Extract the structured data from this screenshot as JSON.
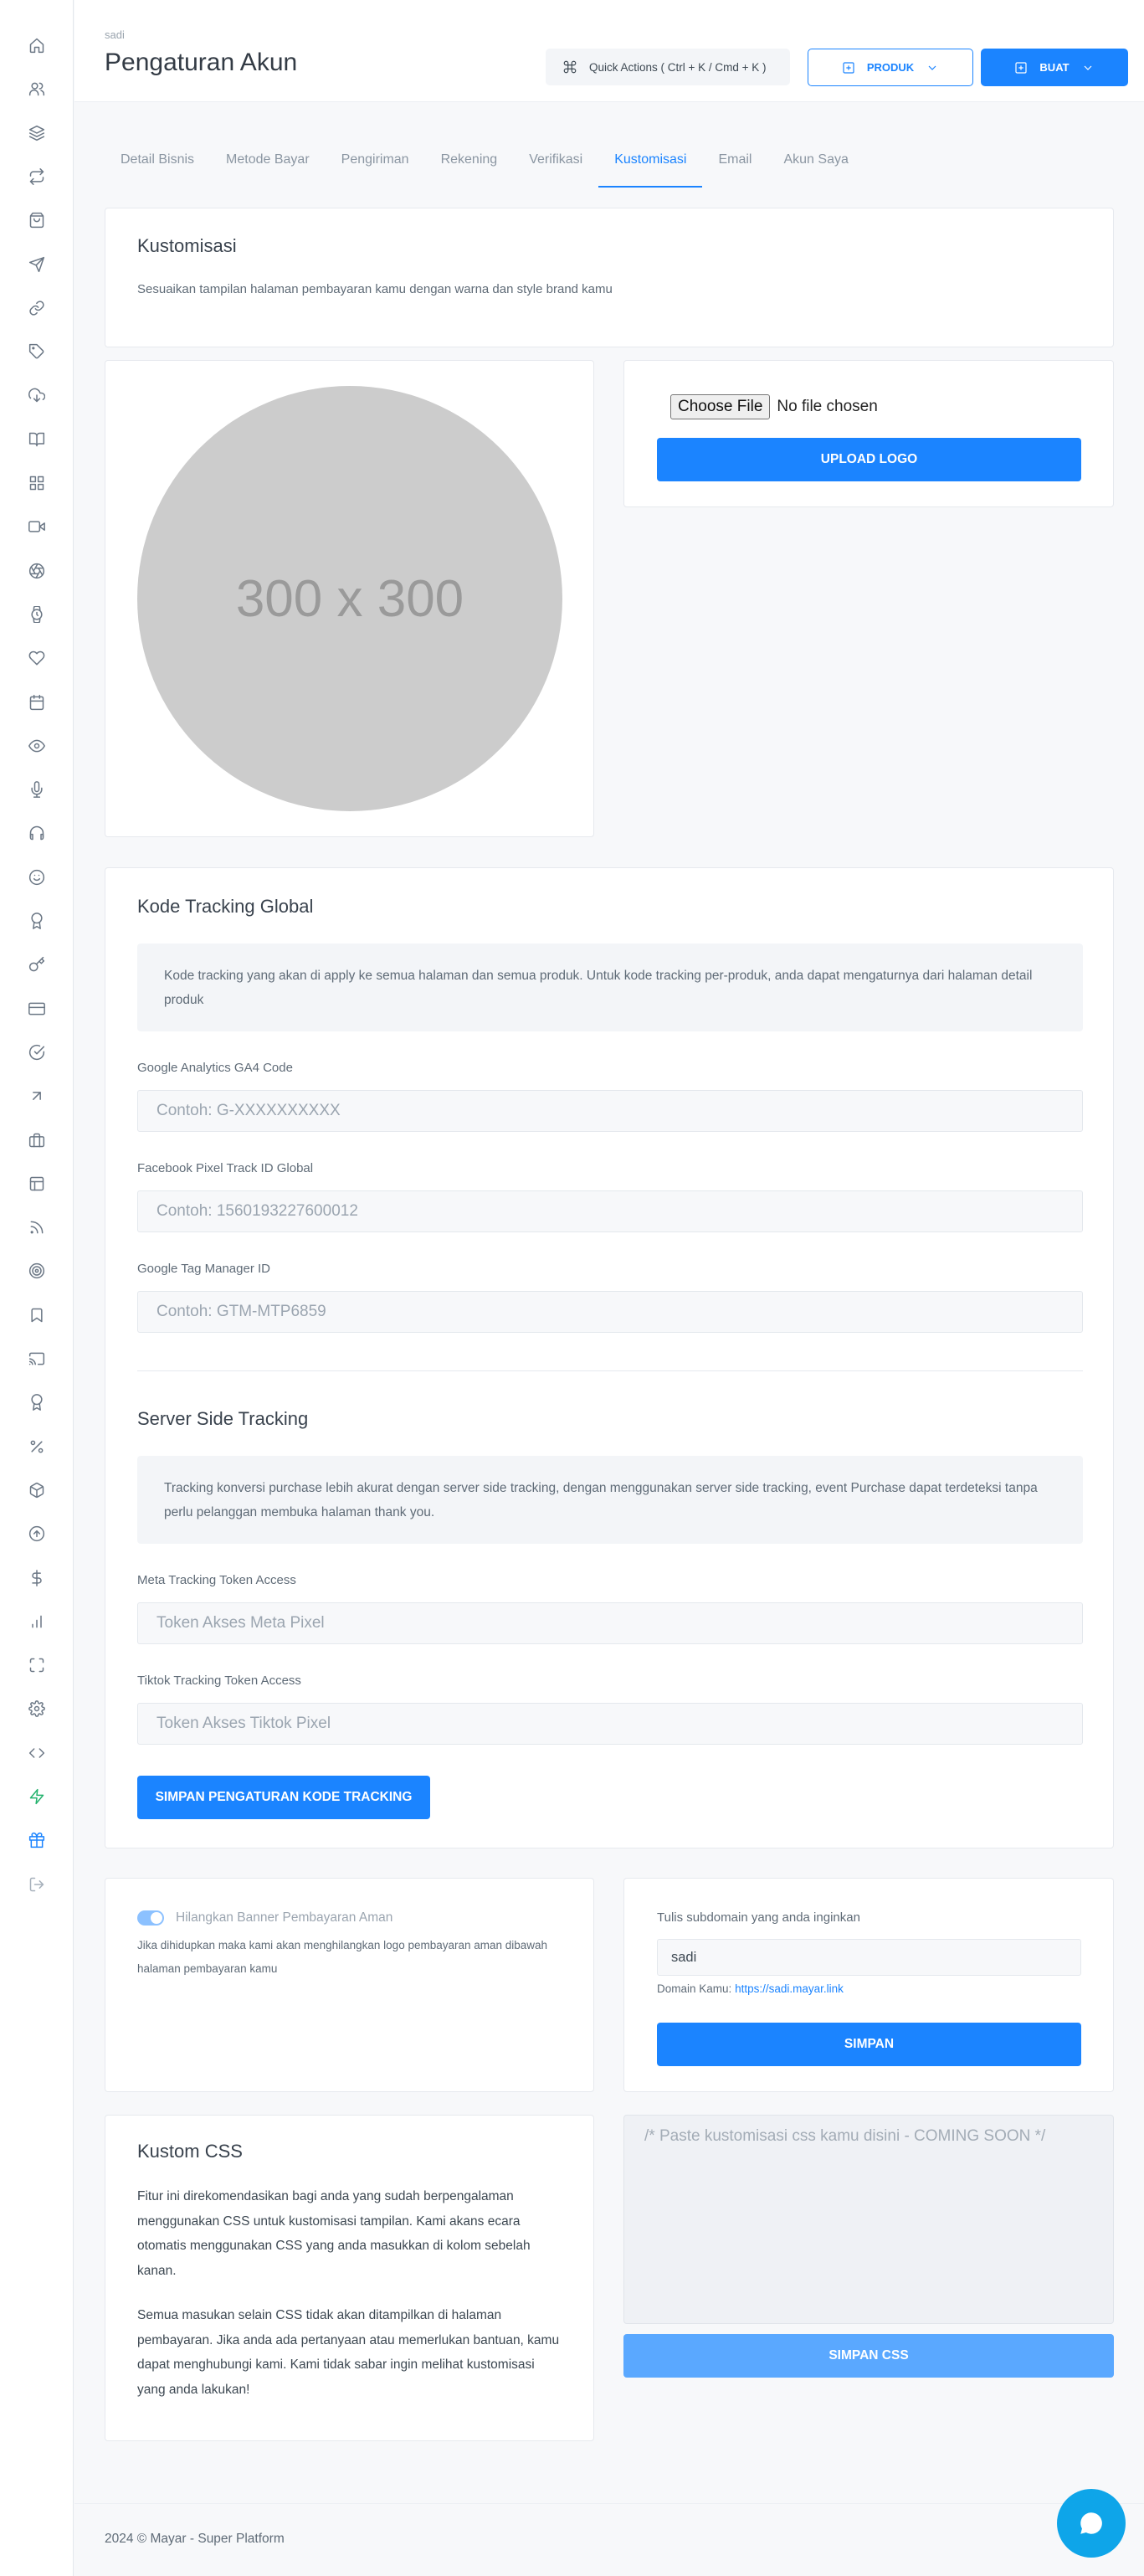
{
  "header": {
    "breadcrumb": "sadi",
    "title": "Pengaturan Akun",
    "quick_actions": "Quick Actions ( Ctrl + K / Cmd + K )",
    "produk_button": "PRODUK",
    "buat_button": "BUAT"
  },
  "tabs": [
    "Detail Bisnis",
    "Metode Bayar",
    "Pengiriman",
    "Rekening",
    "Verifikasi",
    "Kustomisasi",
    "Email",
    "Akun Saya"
  ],
  "active_tab": "Kustomisasi",
  "kustomisasi": {
    "title": "Kustomisasi",
    "description": "Sesuaikan tampilan halaman pembayaran kamu dengan warna dan style brand kamu"
  },
  "logo": {
    "placeholder_text": "300 x 300",
    "choose_file": "Choose File",
    "no_file": "No file chosen",
    "upload_button": "UPLOAD LOGO"
  },
  "tracking": {
    "title": "Kode Tracking Global",
    "info": "Kode tracking yang akan di apply ke semua halaman dan semua produk. Untuk kode tracking per-produk, anda dapat mengaturnya dari halaman detail produk",
    "ga4_label": "Google Analytics GA4 Code",
    "ga4_placeholder": "Contoh: G-XXXXXXXXXX",
    "fb_label": "Facebook Pixel Track ID Global",
    "fb_placeholder": "Contoh: 1560193227600012",
    "gtm_label": "Google Tag Manager ID",
    "gtm_placeholder": "Contoh: GTM-MTP6859",
    "server_title": "Server Side Tracking",
    "server_info": "Tracking konversi purchase lebih akurat dengan server side tracking, dengan menggunakan server side tracking, event Purchase dapat terdeteksi tanpa perlu pelanggan membuka halaman thank you.",
    "meta_label": "Meta Tracking Token Access",
    "meta_placeholder": "Token Akses Meta Pixel",
    "tiktok_label": "Tiktok Tracking Token Access",
    "tiktok_placeholder": "Token Akses Tiktok Pixel",
    "save_button": "SIMPAN PENGATURAN KODE TRACKING"
  },
  "banner": {
    "toggle_label": "Hilangkan Banner Pembayaran Aman",
    "toggle_on": true,
    "description": "Jika dihidupkan maka kami akan menghilangkan logo pembayaran aman dibawah halaman pembayaran kamu"
  },
  "subdomain": {
    "label": "Tulis subdomain yang anda inginkan",
    "value": "sadi",
    "domain_label": "Domain Kamu:",
    "domain_link": "https://sadi.mayar.link",
    "save_button": "SIMPAN"
  },
  "css": {
    "title": "Kustom CSS",
    "paragraph1": "Fitur ini direkomendasikan bagi anda yang sudah berpengalaman menggunakan CSS untuk kustomisasi tampilan. Kami akans ecara otomatis menggunakan CSS yang anda masukkan di kolom sebelah kanan.",
    "paragraph2": "Semua masukan selain CSS tidak akan ditampilkan di halaman pembayaran. Jika anda ada pertanyaan atau memerlukan bantuan, kamu dapat menghubungi kami. Kami tidak sabar ingin melihat kustomisasi yang anda lakukan!",
    "placeholder": "/* Paste kustomisasi css kamu disini - COMING SOON */",
    "save_button": "SIMPAN CSS"
  },
  "footer": "2024 © Mayar - Super Platform",
  "colors": {
    "primary": "#1b84ff",
    "success": "#23b26d",
    "fab": "#0ea5e9"
  },
  "sidebar_icons": [
    "home-icon",
    "users-icon",
    "layers-icon",
    "repeat-icon",
    "shopping-bag-icon",
    "send-icon",
    "link-icon",
    "tag-icon",
    "cloud-download-icon",
    "book-icon",
    "grid-icon",
    "video-icon",
    "aperture-icon",
    "watch-icon",
    "heart-icon",
    "calendar-icon",
    "eye-icon",
    "mic-icon",
    "headphones-icon",
    "smile-icon",
    "award-icon",
    "key-icon",
    "credit-card-icon",
    "check-circle-icon",
    "arrow-up-right-icon",
    "briefcase-icon",
    "layout-icon",
    "rss-icon",
    "target-icon",
    "bookmark-icon",
    "cast-icon",
    "award-icon",
    "percent-icon",
    "box-icon",
    "arrow-up-circle-icon",
    "dollar-icon",
    "bar-chart-icon",
    "maximize-icon",
    "settings-icon",
    "code-icon",
    "zap-icon",
    "gift-icon",
    "log-out-icon"
  ]
}
